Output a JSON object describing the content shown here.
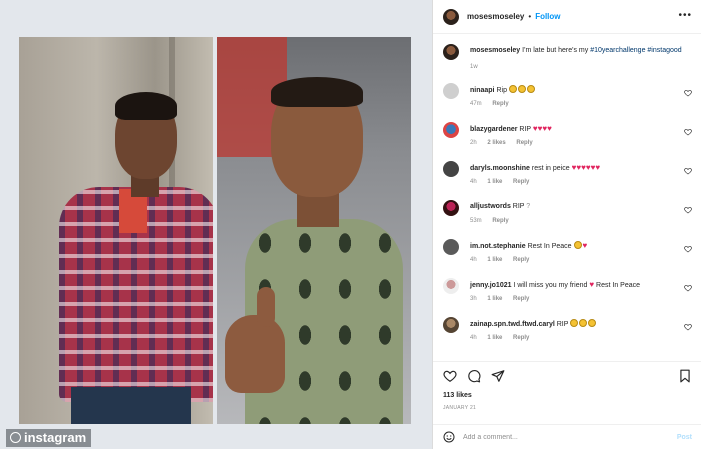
{
  "watermark": "instagram",
  "post": {
    "username": "mosesmoseley",
    "separator": "•",
    "follow_label": "Follow",
    "caption_username": "mosesmoseley",
    "caption_text": "I'm late but here's my",
    "caption_tags": "#10yearchallenge #instagood",
    "caption_time": "1w"
  },
  "comments": [
    {
      "username": "ninaapi",
      "text": "Rip",
      "emoji": "pleading-face x3",
      "time": "47m",
      "likes": "",
      "reply": "Reply"
    },
    {
      "username": "blazygardener",
      "text": "RIP",
      "hearts": "♥♥♥♥",
      "time": "2h",
      "likes": "2 likes",
      "reply": "Reply"
    },
    {
      "username": "daryls.moonshine",
      "text": "rest in peice",
      "hearts": "♥♥♥♥♥♥",
      "time": "4h",
      "likes": "1 like",
      "reply": "Reply"
    },
    {
      "username": "alljustwords",
      "text": "RIP",
      "suffix": "?",
      "time": "53m",
      "likes": "",
      "reply": "Reply"
    },
    {
      "username": "im.not.stephanie",
      "text": "Rest In Peace",
      "hearts": "♥",
      "time": "4h",
      "likes": "1 like",
      "reply": "Reply"
    },
    {
      "username": "jenny.jo1021",
      "text": "I will miss you my friend",
      "hearts": "♥",
      "text2": "Rest In Peace",
      "time": "3h",
      "likes": "1 like",
      "reply": "Reply"
    },
    {
      "username": "zainap.spn.twd.ftwd.caryl",
      "text": "RIP",
      "time": "4h",
      "likes": "1 like",
      "reply": "Reply"
    }
  ],
  "footer": {
    "likes": "113 likes",
    "date": "JANUARY 21",
    "comment_placeholder": "Add a comment...",
    "post_label": "Post"
  },
  "colors": {
    "link": "#0095f6",
    "heart": "#e0245e",
    "meta": "#8e8e8e"
  }
}
